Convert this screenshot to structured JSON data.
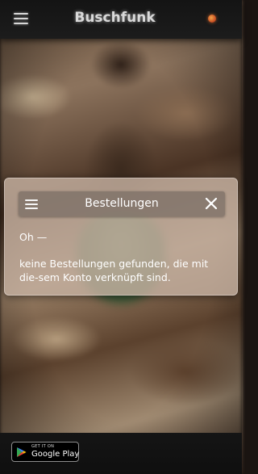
{
  "header": {
    "app_title": "Buschfunk",
    "menu_icon": "hamburger-menu-icon",
    "logo_icon": "app-logo-icon"
  },
  "dialog": {
    "title": "Bestellungen",
    "menu_icon": "hamburger-menu-icon",
    "close_icon": "close-icon",
    "line1": "Oh —",
    "line2": "keine Bestellungen gefunden, die mit die-sem Konto verknüpft sind."
  },
  "footer": {
    "badge_small": "GET IT ON",
    "badge_large": "Google Play",
    "badge_icon": "google-play-icon"
  },
  "colors": {
    "topbar": "#1a1a1a",
    "dialog_bg": "#c4b0a0",
    "dialog_header": "#786c64"
  }
}
